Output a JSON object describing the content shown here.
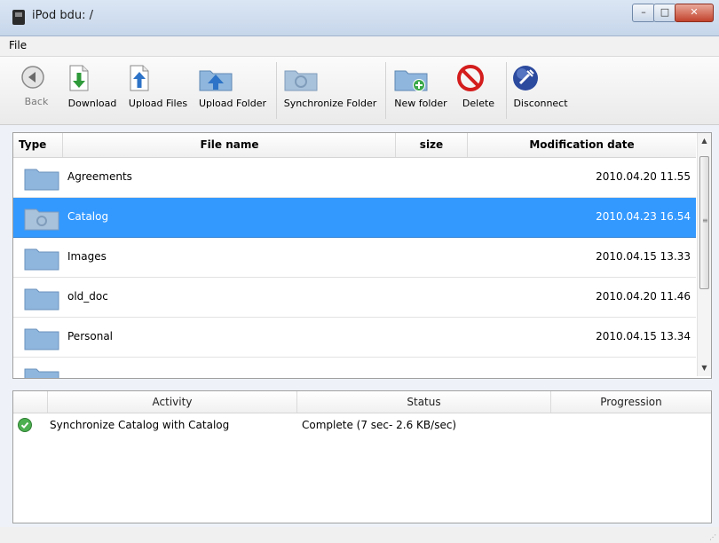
{
  "window": {
    "title": "iPod bdu: /",
    "minimize": "–",
    "maximize": "□",
    "close": "✕"
  },
  "menu": {
    "file": "File"
  },
  "toolbar": {
    "back": "Back",
    "download": "Download",
    "upload_files": "Upload Files",
    "upload_folder": "Upload Folder",
    "synchronize_folder": "Synchronize Folder",
    "new_folder": "New folder",
    "delete": "Delete",
    "disconnect": "Disconnect"
  },
  "file_list": {
    "headers": {
      "type": "Type",
      "name": "File name",
      "size": "size",
      "date": "Modification date"
    },
    "rows": [
      {
        "name": "Agreements",
        "date": "2010.04.20 11.55",
        "icon": "folder-icon",
        "selected": false
      },
      {
        "name": "Catalog",
        "date": "2010.04.23 16.54",
        "icon": "sync-folder-icon",
        "selected": true
      },
      {
        "name": "Images",
        "date": "2010.04.15 13.33",
        "icon": "folder-icon",
        "selected": false
      },
      {
        "name": "old_doc",
        "date": "2010.04.20 11.46",
        "icon": "folder-icon",
        "selected": false
      },
      {
        "name": "Personal",
        "date": "2010.04.15 13.34",
        "icon": "folder-icon",
        "selected": false
      }
    ]
  },
  "activity": {
    "headers": {
      "activity": "Activity",
      "status": "Status",
      "progression": "Progression"
    },
    "rows": [
      {
        "icon": "check-icon",
        "activity": "Synchronize Catalog with Catalog",
        "status": "Complete (7 sec- 2.6 KB/sec)",
        "progression": ""
      }
    ]
  },
  "colors": {
    "selection": "#3399ff",
    "folder": "#8fb6dd"
  }
}
